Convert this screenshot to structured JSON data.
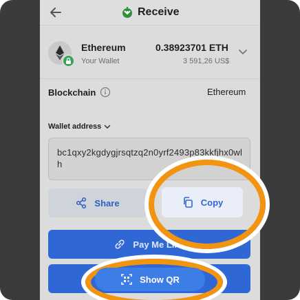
{
  "header": {
    "title": "Receive",
    "back_icon": "arrow-left-icon",
    "title_icon": "receive-arrow-icon"
  },
  "wallet": {
    "coin_name": "Ethereum",
    "wallet_label": "Your Wallet",
    "amount": "0.38923701 ETH",
    "fiat_amount": "3 591,26 US$",
    "icon": "ethereum-icon",
    "badge_icon": "lock-icon"
  },
  "blockchain": {
    "label": "Blockchain",
    "value": "Ethereum",
    "info_icon": "info-icon"
  },
  "address": {
    "label": "Wallet address",
    "value": "bc1qxy2kgdygjrsqtzq2n0yrf2493p83kkfjhx0wlh"
  },
  "actions": {
    "share_label": "Share",
    "copy_label": "Copy",
    "pay_me_link_label": "Pay Me Link",
    "show_qr_label": "Show QR"
  },
  "colors": {
    "highlight_ring": "#f39410",
    "primary_blue": "#2f68d4"
  }
}
